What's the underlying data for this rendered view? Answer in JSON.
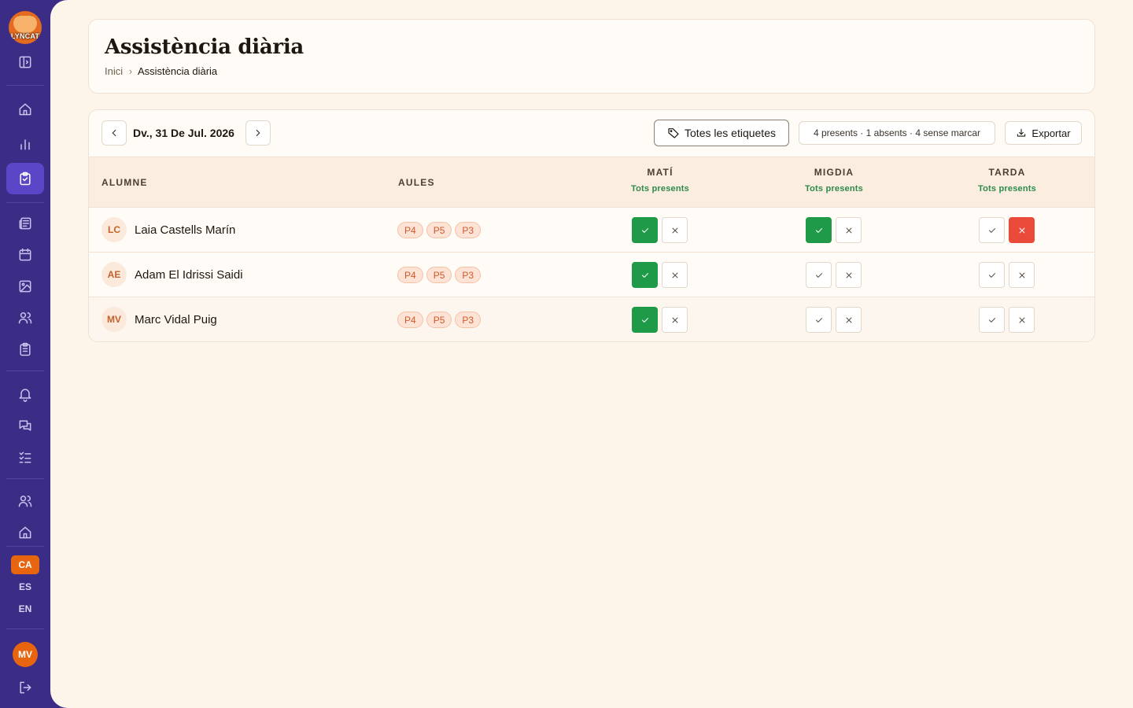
{
  "app": {
    "logo_text": "LYNCAT"
  },
  "sidebar": {
    "languages": [
      {
        "code": "CA",
        "active": true
      },
      {
        "code": "ES",
        "active": false
      },
      {
        "code": "EN",
        "active": false
      }
    ],
    "user_initials": "MV"
  },
  "header": {
    "title": "Assistència diària",
    "breadcrumb": {
      "home": "Inici",
      "separator": "›",
      "current": "Assistència diària"
    }
  },
  "toolbar": {
    "date": "Dv., 31 De Jul. 2026",
    "tags_filter": "Totes les etiquetes",
    "summary": "4 presents · 1 absents · 4 sense marcar",
    "export": "Exportar"
  },
  "table": {
    "col_student": "ALUMNE",
    "col_classes": "AULES",
    "sessions": [
      {
        "name": "MATÍ",
        "all_present": "Tots presents"
      },
      {
        "name": "MIGDIA",
        "all_present": "Tots presents"
      },
      {
        "name": "TARDA",
        "all_present": "Tots presents"
      }
    ],
    "rows": [
      {
        "initials": "LC",
        "name": "Laia Castells Marín",
        "classes": [
          "P4",
          "P5",
          "P3"
        ],
        "status": [
          "present",
          "present",
          "absent"
        ]
      },
      {
        "initials": "AE",
        "name": "Adam El Idrissi Saidi",
        "classes": [
          "P4",
          "P5",
          "P3"
        ],
        "status": [
          "present",
          "none",
          "none"
        ]
      },
      {
        "initials": "MV",
        "name": "Marc Vidal Puig",
        "classes": [
          "P4",
          "P5",
          "P3"
        ],
        "status": [
          "present",
          "none",
          "none"
        ]
      }
    ]
  },
  "colors": {
    "accent": "#3b2c85",
    "present": "#1f9a48",
    "absent": "#e94a3a",
    "brand_orange": "#e8650f"
  }
}
